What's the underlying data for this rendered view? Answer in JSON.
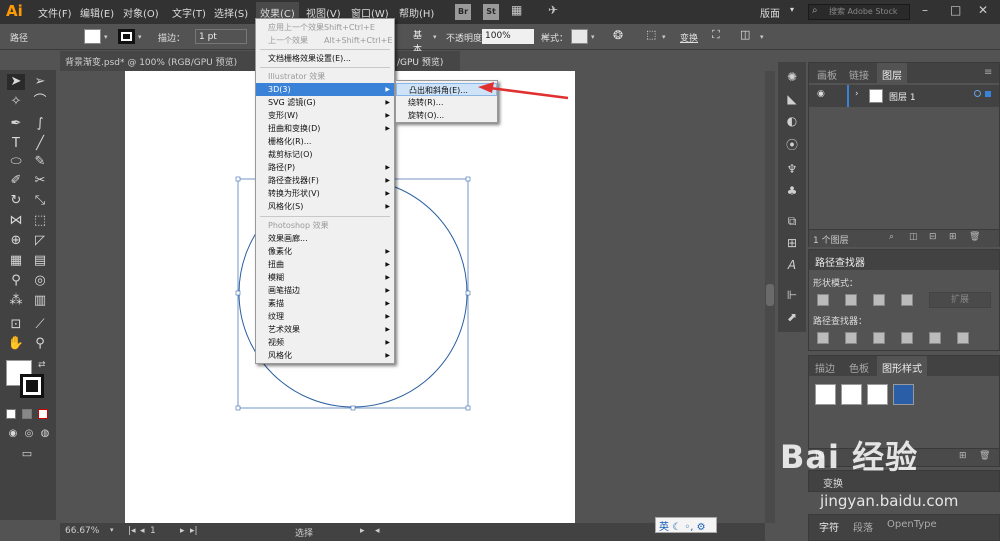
{
  "menubar": {
    "logo": "Ai",
    "items": [
      "文件(F)",
      "编辑(E)",
      "对象(O)",
      "文字(T)",
      "选择(S)",
      "效果(C)",
      "视图(V)",
      "窗口(W)",
      "帮助(H)"
    ],
    "br": "Br",
    "st": "St",
    "workspace": "版面",
    "stock_search_placeholder": "搜索 Adobe Stock"
  },
  "controlbar": {
    "label": "路径",
    "stroke_label": "描边：",
    "stroke_value": "1 pt",
    "basic": "基本",
    "opacity_label": "不透明度：",
    "opacity_value": "100%",
    "style_label": "样式：",
    "transform": "变换"
  },
  "document": {
    "tab_title": "背景渐变.psd* @ 100% (RGB/GPU 预览)",
    "tab_title_tail": "/GPU 预览)"
  },
  "statusbar": {
    "zoom": "66.67%",
    "page": "1",
    "mode": "选择"
  },
  "effect_menu": {
    "apply_last": "应用上一个效果",
    "apply_last_sc": "Shift+Ctrl+E",
    "last_effect": "上一个效果",
    "last_effect_sc": "Alt+Shift+Ctrl+E",
    "raster_settings": "文档栅格效果设置(E)...",
    "illustrator_section": "Illustrator 效果",
    "illustrator_items": [
      "3D(3)",
      "SVG 滤镜(G)",
      "变形(W)",
      "扭曲和变换(D)",
      "栅格化(R)...",
      "裁剪标记(O)",
      "路径(P)",
      "路径查找器(F)",
      "转换为形状(V)",
      "风格化(S)"
    ],
    "photoshop_section": "Photoshop 效果",
    "photoshop_items": [
      "效果画廊...",
      "像素化",
      "扭曲",
      "模糊",
      "画笔描边",
      "素描",
      "纹理",
      "艺术效果",
      "视频",
      "风格化"
    ]
  },
  "submenu_3d": {
    "items": [
      "凸出和斜角(E)...",
      "绕转(R)...",
      "旋转(O)..."
    ]
  },
  "layers_panel": {
    "tabs": [
      "画板",
      "链接",
      "图层"
    ],
    "layer_name": "图层 1",
    "footer": "1 个图层"
  },
  "pathfinder_panel": {
    "title": "路径查找器",
    "shape_modes": "形状模式：",
    "expand": "扩展",
    "pathfinders": "路径查找器："
  },
  "styles_panel": {
    "tabs": [
      "描边",
      "色板",
      "图形样式"
    ]
  },
  "bottom_panels": {
    "transform": "变换",
    "tabs": [
      "字符",
      "段落",
      "OpenType"
    ]
  },
  "ime": {
    "label": "英"
  },
  "watermark": {
    "brand": "Bai 经验",
    "url": "jingyan.baidu.com"
  },
  "colors": {
    "highlight": "#3a82d8",
    "arrow": "#e03030",
    "circle_stroke": "#2a5fa0"
  }
}
